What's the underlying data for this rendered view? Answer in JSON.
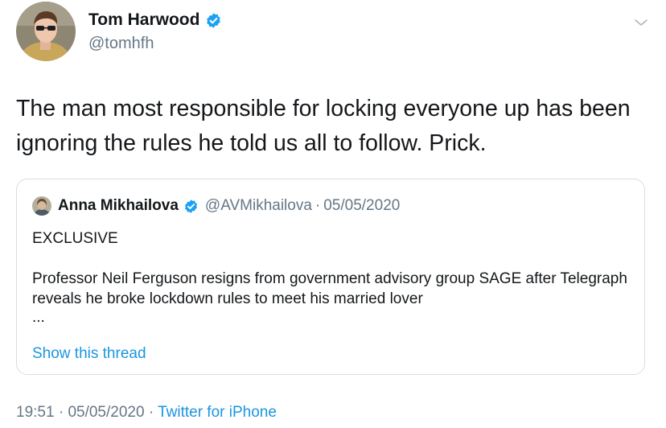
{
  "author": {
    "display_name": "Tom Harwood",
    "handle": "@tomhfh",
    "verified": true,
    "avatar_icon": "profile-photo-icon"
  },
  "tweet": {
    "text": "The man most responsible for locking everyone up has been ignoring the rules he told us all to follow. Prick."
  },
  "quoted_tweet": {
    "display_name": "Anna Mikhailova",
    "handle": "@AVMikhailova",
    "separator": "·",
    "date": "05/05/2020",
    "verified": true,
    "heading": "EXCLUSIVE",
    "body": "Professor Neil Ferguson resigns from government advisory group SAGE after Telegraph reveals he broke lockdown rules to meet his married lover",
    "ellipsis": "...",
    "thread_link": "Show this thread"
  },
  "meta": {
    "time": "19:51",
    "separator": "·",
    "date": "05/05/2020",
    "source": "Twitter for iPhone"
  },
  "colors": {
    "link": "#1b95e0",
    "secondary_text": "#657786",
    "border": "#d7dee3",
    "verified": "#1da1f2"
  }
}
